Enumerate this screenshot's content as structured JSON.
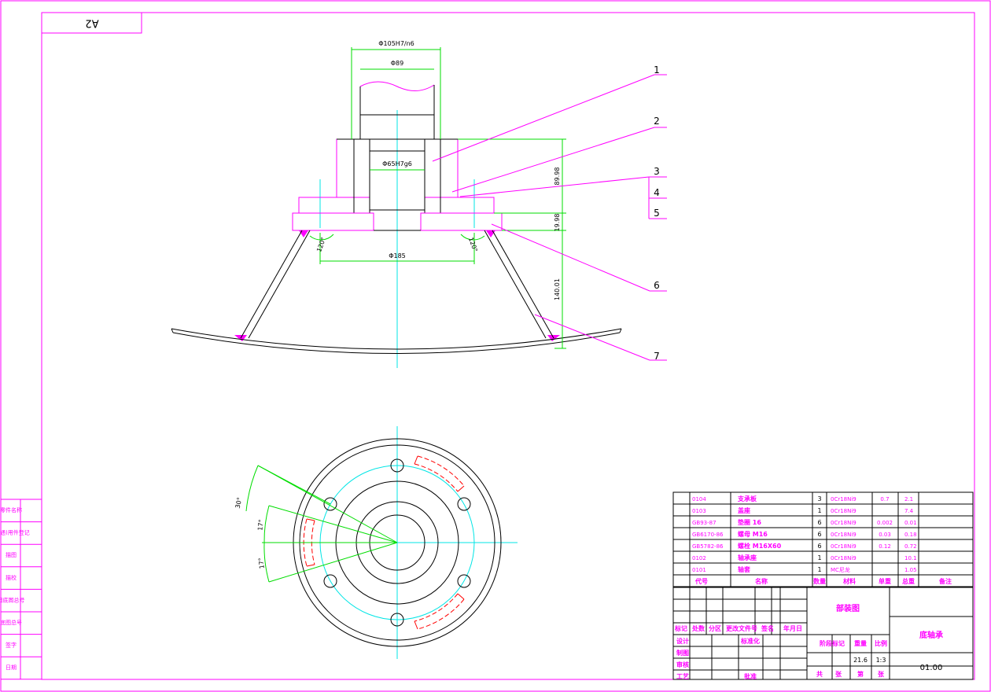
{
  "sheet_size_label": "A2",
  "dimensions": {
    "shaft_fit": "Φ105H7/n6",
    "shaft_dia": "Φ89",
    "bore_fit": "Φ65H7g6",
    "base_dia": "Φ185",
    "height_upper": "89.98",
    "height_plate": "19.98",
    "height_lower": "140.01",
    "angle_left": "120°",
    "angle_right": "120°",
    "angle_30": "30°",
    "angle_17a": "17°",
    "angle_17b": "17°"
  },
  "balloons": [
    "1",
    "2",
    "3",
    "4",
    "5",
    "6",
    "7"
  ],
  "left_strip": [
    "零件名称",
    "借(通)用件登记",
    "描图",
    "描校",
    "旧底图总号",
    "底图总号",
    "签字",
    "日期"
  ],
  "parts_list": {
    "headers": [
      "代号",
      "名称",
      "数量",
      "材料",
      "单重",
      "总重",
      "备注"
    ],
    "rows": [
      {
        "code": "0104",
        "name": "支承板",
        "qty": "3",
        "material": "0Cr18Ni9",
        "unit_wt": "0.7",
        "total_wt": "2.1",
        "note": ""
      },
      {
        "code": "0103",
        "name": "盖座",
        "qty": "1",
        "material": "0Cr18Ni9",
        "unit_wt": "",
        "total_wt": "7.4",
        "note": ""
      },
      {
        "code": "GB93-87",
        "name": "垫圈 16",
        "qty": "6",
        "material": "0Cr18Ni9",
        "unit_wt": "0.002",
        "total_wt": "0.01",
        "note": ""
      },
      {
        "code": "GB6170-86",
        "name": "螺母 M16",
        "qty": "6",
        "material": "0Cr18Ni9",
        "unit_wt": "0.03",
        "total_wt": "0.18",
        "note": ""
      },
      {
        "code": "GB5782-86",
        "name": "螺栓 M16X60",
        "qty": "6",
        "material": "0Cr18Ni9",
        "unit_wt": "0.12",
        "total_wt": "0.72",
        "note": ""
      },
      {
        "code": "0102",
        "name": "轴承座",
        "qty": "1",
        "material": "0Cr18Ni9",
        "unit_wt": "",
        "total_wt": "10.1",
        "note": ""
      },
      {
        "code": "0101",
        "name": "轴套",
        "qty": "1",
        "material": "MC尼龙",
        "unit_wt": "",
        "total_wt": "1.05",
        "note": ""
      }
    ]
  },
  "title_block": {
    "drawing_type": "部装图",
    "title": "底轴承",
    "drawing_no": "01.00",
    "weight": "21.6",
    "scale": "1:3",
    "rev_headers": [
      "标记",
      "处数",
      "分区",
      "更改文件号",
      "签名",
      "年月日"
    ],
    "roles": [
      "设计",
      "制图",
      "审核",
      "工艺"
    ],
    "standardization": "标准化",
    "approve": "批准",
    "stage_mark": "阶段标记",
    "weight_label": "重量",
    "scale_label": "比例",
    "sheets_total": "共",
    "sheet_unit_1": "张",
    "sheet_nth": "第",
    "sheet_unit_2": "张"
  },
  "colors": {
    "outline": "#ff00ff",
    "object": "#000000",
    "dimension": "#00dd00",
    "centerline": "#00e5e5",
    "hidden": "#ff0000",
    "section_hatch": "#e6a050"
  }
}
